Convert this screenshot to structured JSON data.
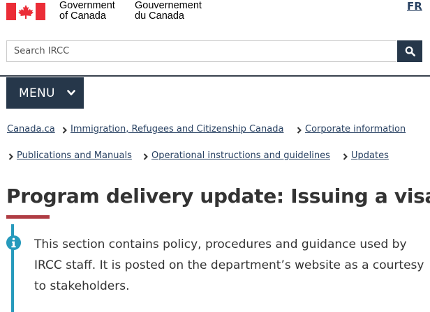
{
  "header": {
    "signature_en": [
      "Government",
      "of Canada"
    ],
    "signature_fr": [
      "Gouvernement",
      "du Canada"
    ],
    "language_toggle": "FR"
  },
  "search": {
    "placeholder": "Search IRCC",
    "button_icon": "search-icon"
  },
  "menu": {
    "label": "MENU",
    "icon": "chevron-down-icon"
  },
  "breadcrumb": [
    "Canada.ca",
    "Immigration, Refugees and Citizenship Canada",
    "Corporate information",
    "Publications and Manuals",
    "Operational instructions and guidelines",
    "Updates"
  ],
  "main": {
    "title": "Program delivery update: Issuing a visa",
    "notice": {
      "icon": "info-icon",
      "text": "This section contains policy, procedures and guidance used by IRCC staff. It is posted on the department’s website as a courtesy to stakeholders."
    }
  },
  "colors": {
    "navy": "#26374a",
    "link": "#284162",
    "flag_red": "#eb2d37",
    "accent_red": "#af3c43",
    "info_blue": "#269abc"
  }
}
